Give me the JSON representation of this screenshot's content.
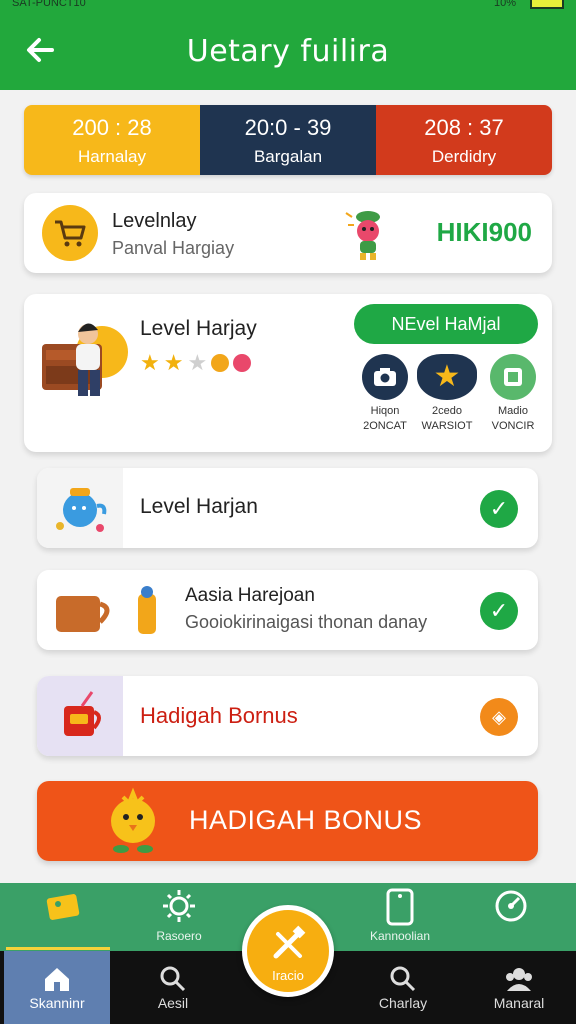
{
  "status": {
    "left": "SAT-PUNCT10",
    "right": "10%",
    "battery_color": "#e6ef3a"
  },
  "header": {
    "title": "Uetary fuilira",
    "back_icon": "arrow-left-icon"
  },
  "stats": [
    {
      "value": "200 : 28",
      "label": "Harnalay",
      "color": "#f7b81a"
    },
    {
      "value": "20:0 - 39",
      "label": "Bargalan",
      "color": "#1f3450"
    },
    {
      "value": "208 : 37",
      "label": "Derdidry",
      "color": "#d23a1c"
    }
  ],
  "level_card": {
    "title": "Levelnlay",
    "subtitle": "Panval Hargiay",
    "code": "HIKI900",
    "icon": "cart-icon"
  },
  "profile_card": {
    "title": "Level Harjay",
    "stars": 2,
    "stars_total": 3,
    "badge_label": "NEvel HaMjal",
    "achievements": [
      {
        "line1": "Hiqon",
        "line2": "2ONCAT",
        "color": "#1f3450",
        "icon": "camera-icon"
      },
      {
        "line1": "2cedo",
        "line2": "WARSIOT",
        "color": "#1f3450",
        "icon": "star-cloud-icon"
      },
      {
        "line1": "Madio",
        "line2": "VONCIR",
        "color": "#59b86c",
        "icon": "frame-icon"
      }
    ]
  },
  "rows": {
    "r1": {
      "label": "Level Harjan",
      "done": true
    },
    "r2": {
      "line1": "Aasia Harejoan",
      "line2": "Gooiokirinaigasi thonan danay",
      "done": true
    },
    "r3": {
      "label": "Hadigah Bornus"
    }
  },
  "bonus": {
    "label": "HADIGAH BONUS"
  },
  "nav_top": [
    {
      "label": "",
      "icon": "map-icon"
    },
    {
      "label": "Rasoero",
      "icon": "sun-icon"
    },
    {
      "label": "Kannoolian",
      "icon": "phone-clock-icon"
    },
    {
      "label": "",
      "icon": "compass-icon"
    }
  ],
  "nav_bottom": [
    {
      "label": "Skanninr",
      "icon": "home-icon",
      "selected": true
    },
    {
      "label": "Aesil",
      "icon": "search-icon"
    },
    {
      "label": "Charlay",
      "icon": "search-icon"
    },
    {
      "label": "Manaral",
      "icon": "users-icon"
    }
  ],
  "fab": {
    "label": "Iracio",
    "icon": "tools-icon"
  }
}
